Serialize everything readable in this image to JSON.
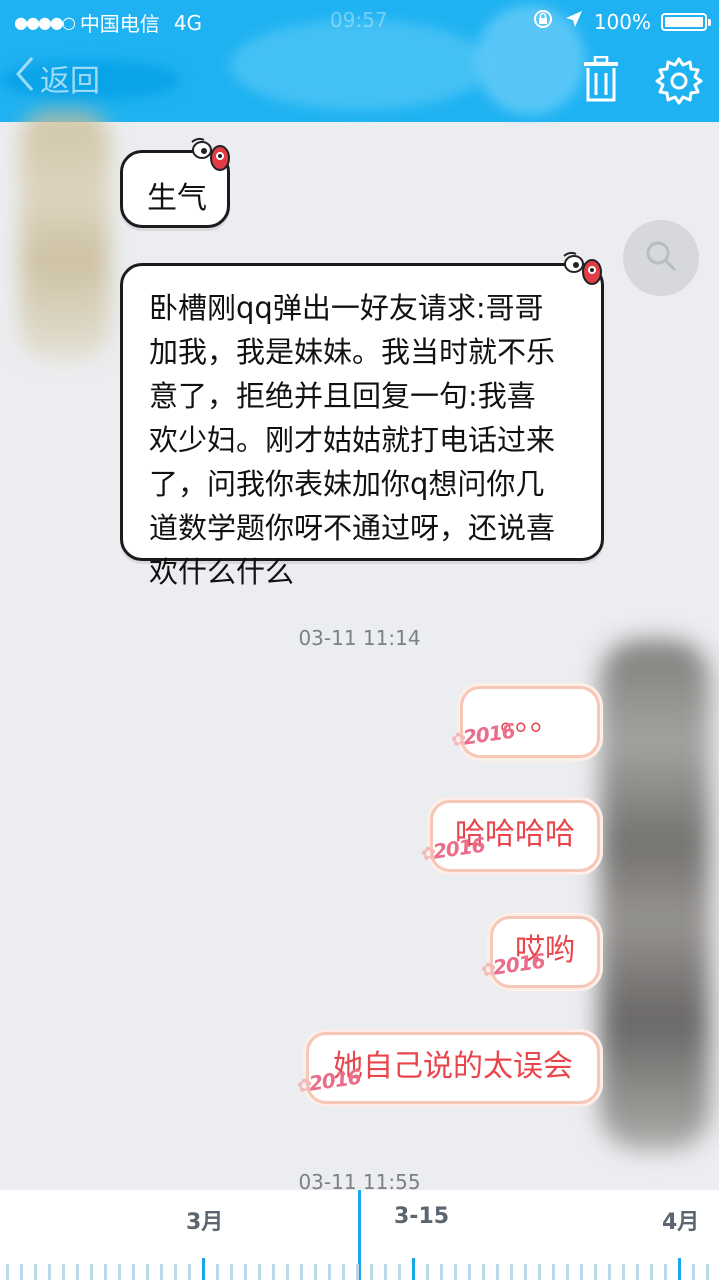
{
  "status_bar": {
    "signal_dots": "●●●●○",
    "carrier": "中国电信",
    "network": "4G",
    "time": "09:57",
    "battery": "100%"
  },
  "nav": {
    "back_label": "返回",
    "icons": [
      "chevron-left-icon",
      "trash-icon",
      "gear-icon"
    ]
  },
  "messages_in": [
    {
      "text": "生气"
    },
    {
      "lines": [
        "卧槽刚qq弹出一好友请求:哥哥",
        "加我，我是妹妹。我当时就不乐",
        "意了，拒绝并且回复一句:我喜",
        "欢少妇。刚才姑姑就打电话过来",
        "了，问我你表妹加你q想问你几",
        "道数学题你呀不通过呀，还说喜",
        "欢什么什么"
      ]
    }
  ],
  "timestamp_1": "03-11 11:14",
  "messages_out": [
    {
      "text": "。。。",
      "tag": "2016"
    },
    {
      "text": "哈哈哈哈",
      "tag": "2016"
    },
    {
      "text": "哎哟",
      "tag": "2016"
    },
    {
      "text": "她自己说的太误会",
      "tag": "2016"
    }
  ],
  "timestamp_2": "03-11 11:55",
  "timeline": {
    "labels": [
      "3月",
      "3-15",
      "4月"
    ],
    "accent": "#1aa7ec"
  },
  "colors": {
    "header": "#1fb2f2",
    "outgoing_text": "#e8454d",
    "outgoing_border": "#f6c6b6"
  }
}
